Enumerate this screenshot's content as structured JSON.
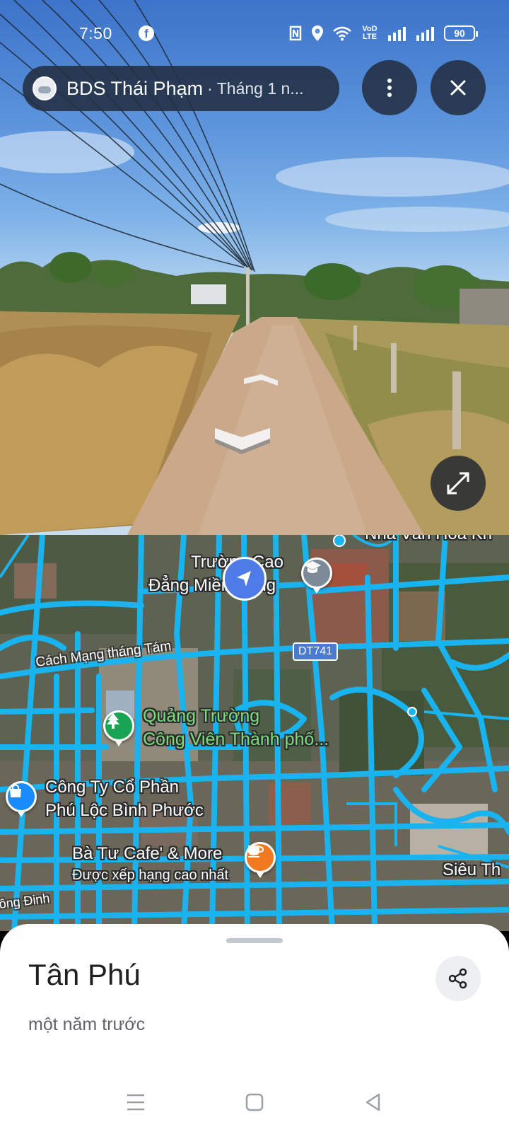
{
  "status_bar": {
    "time": "7:50",
    "network_label": "VoD LTE",
    "battery": "90"
  },
  "header": {
    "title": "BDS Thái Phạm",
    "subtitle": "· Tháng 1 n..."
  },
  "icons": {
    "more": "more-vert-icon",
    "close": "close-icon",
    "expand": "expand-icon",
    "share": "share-icon"
  },
  "map": {
    "labels": {
      "college_line1": "Trường Cao",
      "college_line2": "Đẳng Miền Đông",
      "cultural_house": "Nhà Văn Hóa Kh",
      "road_cmt8": "Cách Mạng tháng Tám",
      "route": "DT741",
      "square_line1": "Quảng Trường",
      "square_line2": "Công Viên Thành phố...",
      "company_line1": "Công Ty Cổ Phần",
      "company_line2": "Phú Lộc Bình Phước",
      "cafe_line1": "Bà Tư Cafe' & More",
      "cafe_line2": "Được xếp hạng cao nhất",
      "supermarket": "Siêu Th",
      "road_bottom": "ông Đinh"
    },
    "colors": {
      "street_view_lines": "#19b4f0",
      "nav_arrow": "#4f7be6",
      "park_pin": "#19a455",
      "shop_pin": "#1a8cff",
      "cafe_pin": "#f07a22",
      "school_pin": "#7d8a98"
    }
  },
  "sheet": {
    "place_name": "Tân Phú",
    "time_ago": "một năm trước"
  }
}
